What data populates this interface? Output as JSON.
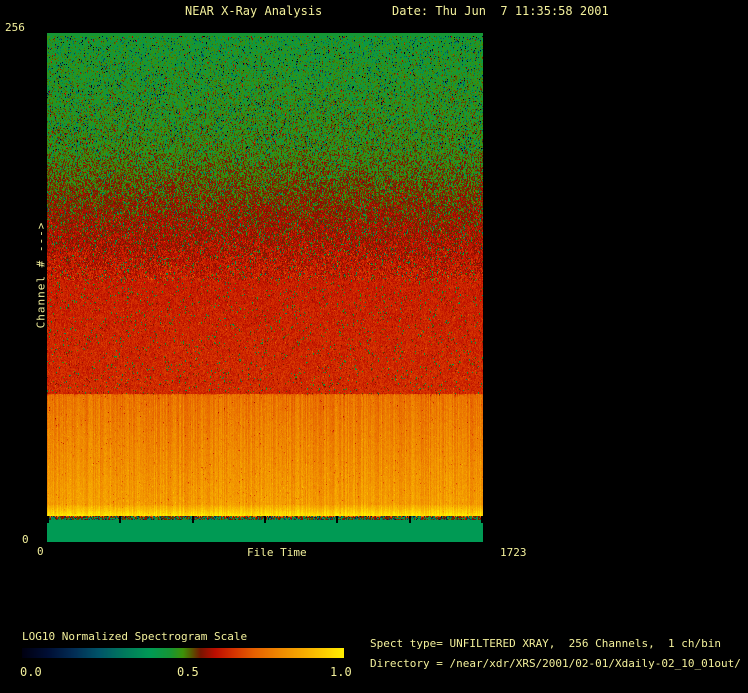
{
  "header": {
    "title": "NEAR X-Ray Analysis",
    "date_label": "Date: Thu Jun  7 11:35:58 2001"
  },
  "plot": {
    "y_axis": {
      "label": "Channel # --->",
      "max_label": "256",
      "min_label": "0"
    },
    "x_axis": {
      "label": "File Time",
      "min_label": "0",
      "max_label": "1723"
    }
  },
  "colorbar": {
    "title": "LOG10 Normalized Spectrogram Scale",
    "tick_labels": {
      "low": "0.0",
      "mid": "0.5",
      "high": "1.0"
    }
  },
  "info": {
    "spect_type_line": "Spect type= UNFILTERED XRAY,  256 Channels,  1 ch/bin",
    "directory_line": "Directory = /near/xdr/XRS/2001/02-01/Xdaily-02_10_01out/"
  },
  "colors": {
    "background": "#000000",
    "text": "#f3f09b",
    "tick_mark": "#000000",
    "solid_band_green": "#009a54",
    "red_zone": "#c51b00",
    "orange_zone": "#ec7e00",
    "yellow_peak": "#ffee00"
  },
  "chart_data": {
    "type": "heatmap",
    "title": "NEAR X-Ray Analysis",
    "xlabel": "File Time",
    "ylabel": "Channel # --->",
    "xlim": [
      0,
      1723
    ],
    "ylim": [
      0,
      256
    ],
    "x_ticks": [
      0,
      1723
    ],
    "y_ticks": [
      0,
      256
    ],
    "grid": false,
    "legend": "colorbar bottom-left",
    "colorbar_label": "LOG10 Normalized Spectrogram Scale",
    "colorbar_range": [
      0.0,
      1.0
    ],
    "colorbar_ticks": [
      0.0,
      0.5,
      1.0
    ],
    "x_tick_mark_count": 7,
    "palette_stops": [
      [
        0.0,
        [
          0,
          0,
          16
        ]
      ],
      [
        0.08,
        [
          0,
          14,
          52
        ]
      ],
      [
        0.16,
        [
          2,
          44,
          84
        ]
      ],
      [
        0.24,
        [
          0,
          84,
          104
        ]
      ],
      [
        0.32,
        [
          0,
          122,
          92
        ]
      ],
      [
        0.4,
        [
          0,
          154,
          84
        ]
      ],
      [
        0.46,
        [
          22,
          150,
          52
        ]
      ],
      [
        0.5,
        [
          60,
          146,
          8
        ]
      ],
      [
        0.53,
        [
          90,
          80,
          0
        ]
      ],
      [
        0.555,
        [
          120,
          20,
          0
        ]
      ],
      [
        0.6,
        [
          188,
          14,
          0
        ]
      ],
      [
        0.66,
        [
          214,
          52,
          0
        ]
      ],
      [
        0.72,
        [
          229,
          95,
          0
        ]
      ],
      [
        0.8,
        [
          239,
          136,
          0
        ]
      ],
      [
        0.88,
        [
          247,
          173,
          0
        ]
      ],
      [
        0.95,
        [
          253,
          210,
          0
        ]
      ],
      [
        1.0,
        [
          255,
          238,
          0
        ]
      ]
    ],
    "regions": [
      {
        "name": "top_edge_line",
        "ch": [
          256.0,
          254.5
        ],
        "v": [
          0.46,
          0.46
        ],
        "spread": 0,
        "dip": [
          0,
          0
        ],
        "spike": [
          0,
          0
        ],
        "stripe": false
      },
      {
        "name": "green_noise",
        "ch": [
          254.5,
          197.0
        ],
        "v": [
          0.46,
          0.5
        ],
        "spread": 0.11,
        "dip": [
          0.1,
          0.5
        ],
        "spike": [
          0.04,
          0.15
        ],
        "stripe": false
      },
      {
        "name": "green_red_mix",
        "ch": [
          197.0,
          131.8
        ],
        "v": [
          0.5,
          0.625
        ],
        "spread": 0.12,
        "dip": [
          0.07,
          0.35
        ],
        "spike": [
          0.05,
          0.1
        ],
        "stripe": false
      },
      {
        "name": "red_noise",
        "ch": [
          131.8,
          74.4
        ],
        "v": [
          0.625,
          0.645
        ],
        "spread": 0.07,
        "dip": [
          0.05,
          0.3
        ],
        "spike": [
          0.02,
          0.08
        ],
        "stripe": false
      },
      {
        "name": "orange_noise",
        "ch": [
          74.4,
          18.6
        ],
        "v": [
          0.755,
          0.845
        ],
        "spread": 0.05,
        "dip": [
          0.02,
          0.15
        ],
        "spike": [
          0.02,
          0.06
        ],
        "stripe": true
      },
      {
        "name": "bright_yellow",
        "ch": [
          18.6,
          12.8
        ],
        "v": [
          0.86,
          0.99
        ],
        "spread": 0.04,
        "dip": [
          0.02,
          0.1
        ],
        "spike": [
          0,
          0
        ],
        "stripe": true
      },
      {
        "name": "dark_axis_line",
        "ch": [
          12.8,
          11.0
        ],
        "v": [
          0.545,
          0.545
        ],
        "spread": 0.04,
        "dip": [
          0.5,
          0.45
        ],
        "spike": [
          0,
          0
        ],
        "stripe": false
      },
      {
        "name": "solid_green_band",
        "ch": [
          11.0,
          0.0
        ],
        "v": [
          0.4,
          0.4
        ],
        "spread": 0,
        "dip": [
          0,
          0
        ],
        "spike": [
          0,
          0
        ],
        "stripe": false
      }
    ]
  }
}
